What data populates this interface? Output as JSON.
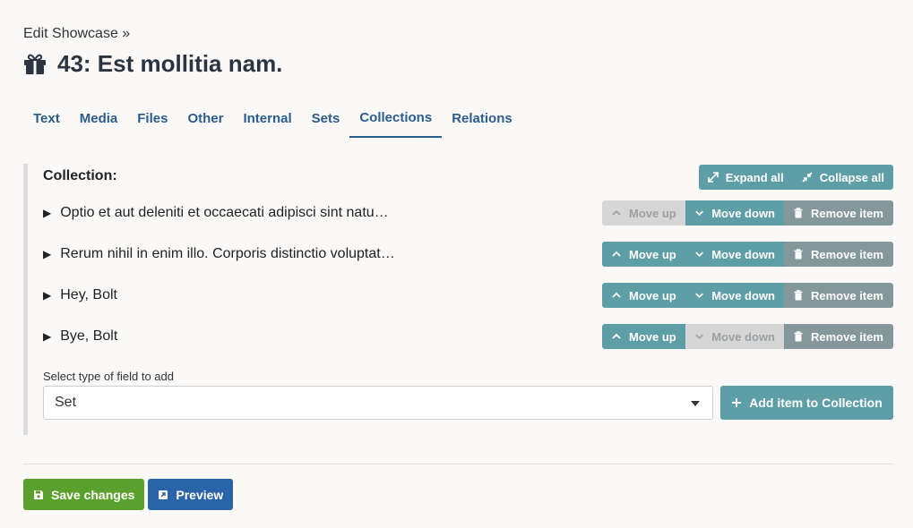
{
  "header": {
    "breadcrumb": "Edit Showcase »",
    "title": "43: Est mollitia nam."
  },
  "tabs": [
    {
      "label": "Text",
      "active": false
    },
    {
      "label": "Media",
      "active": false
    },
    {
      "label": "Files",
      "active": false
    },
    {
      "label": "Other",
      "active": false
    },
    {
      "label": "Internal",
      "active": false
    },
    {
      "label": "Sets",
      "active": false
    },
    {
      "label": "Collections",
      "active": true
    },
    {
      "label": "Relations",
      "active": false
    }
  ],
  "collection": {
    "label": "Collection:",
    "expand_all": "Expand all",
    "collapse_all": "Collapse all",
    "move_up": "Move up",
    "move_down": "Move down",
    "remove_item": "Remove item",
    "items": [
      {
        "title": "Optio et aut deleniti et occaecati adipisci sint natu…",
        "up_enabled": false,
        "down_enabled": true
      },
      {
        "title": "Rerum nihil in enim illo. Corporis distinctio voluptat…",
        "up_enabled": true,
        "down_enabled": true
      },
      {
        "title": "Hey, Bolt",
        "up_enabled": true,
        "down_enabled": true
      },
      {
        "title": "Bye, Bolt",
        "up_enabled": true,
        "down_enabled": false
      }
    ],
    "select_label": "Select type of field to add",
    "select_value": "Set",
    "add_button": "Add item to Collection"
  },
  "footer": {
    "save": "Save changes",
    "preview": "Preview"
  },
  "colors": {
    "teal": "#5e9ea6",
    "gray": "#84979a",
    "green": "#5aa02c",
    "blue": "#2a64a8",
    "link": "#2b5c8e"
  }
}
